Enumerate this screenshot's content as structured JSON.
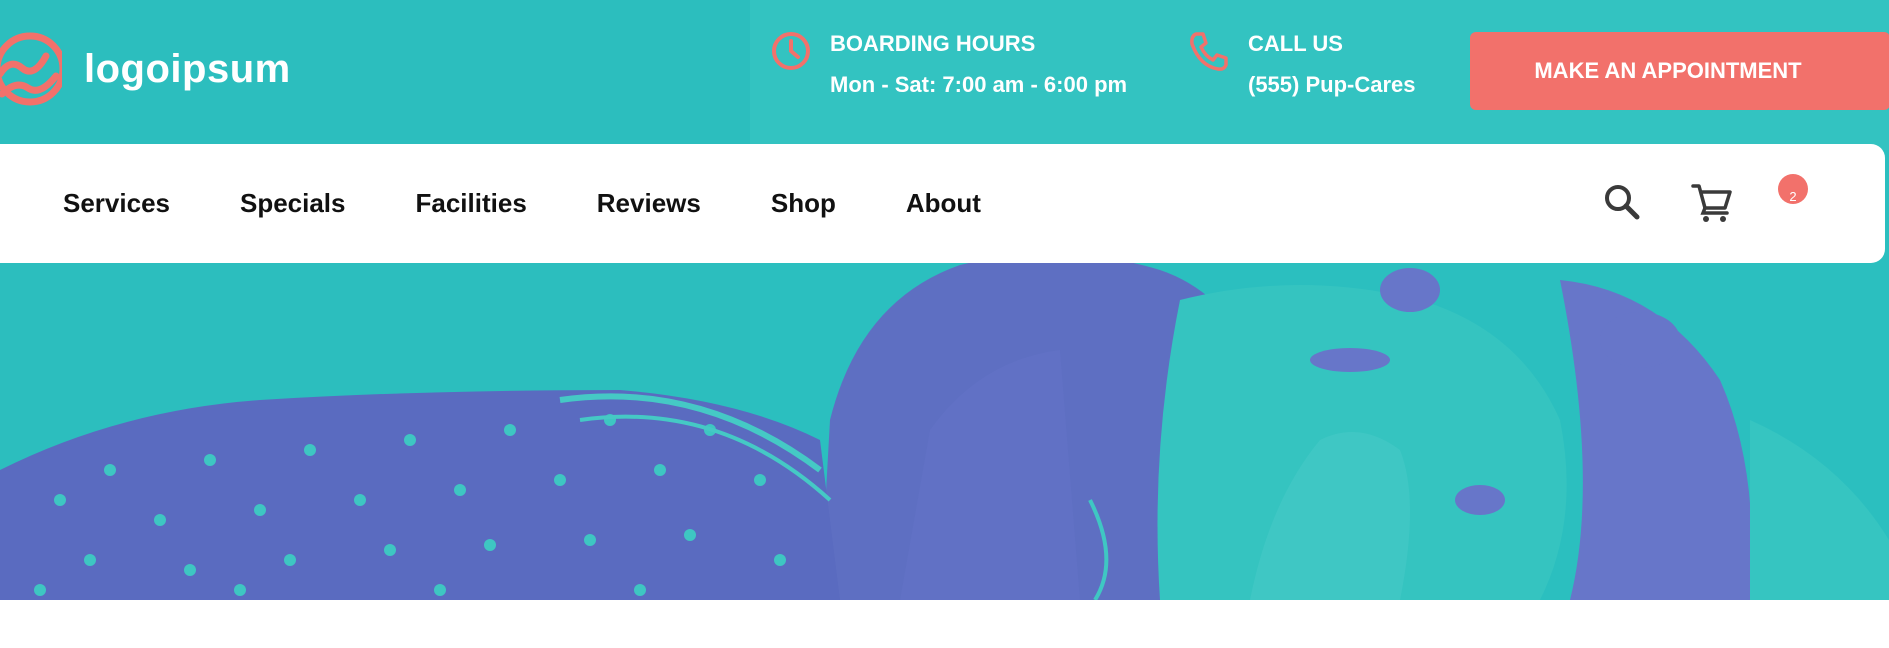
{
  "brand": {
    "logo_text": "logoipsum",
    "accent_color": "#f2716b",
    "hero_color": "#2bbfbf",
    "logo_icon": "wave-circle-icon"
  },
  "header": {
    "hours": {
      "icon": "clock-icon",
      "label": "BOARDING HOURS",
      "value": "Mon - Sat: 7:00 am - 6:00 pm"
    },
    "call": {
      "icon": "phone-icon",
      "label": "CALL US",
      "value": "(555) Pup-Cares"
    },
    "cta_label": "MAKE AN APPOINTMENT"
  },
  "nav": {
    "items": [
      {
        "label": "Services"
      },
      {
        "label": "Specials"
      },
      {
        "label": "Facilities"
      },
      {
        "label": "Reviews"
      },
      {
        "label": "Shop"
      },
      {
        "label": "About"
      }
    ],
    "search_icon": "search-icon",
    "cart_icon": "cart-icon",
    "cart_count": "2"
  }
}
